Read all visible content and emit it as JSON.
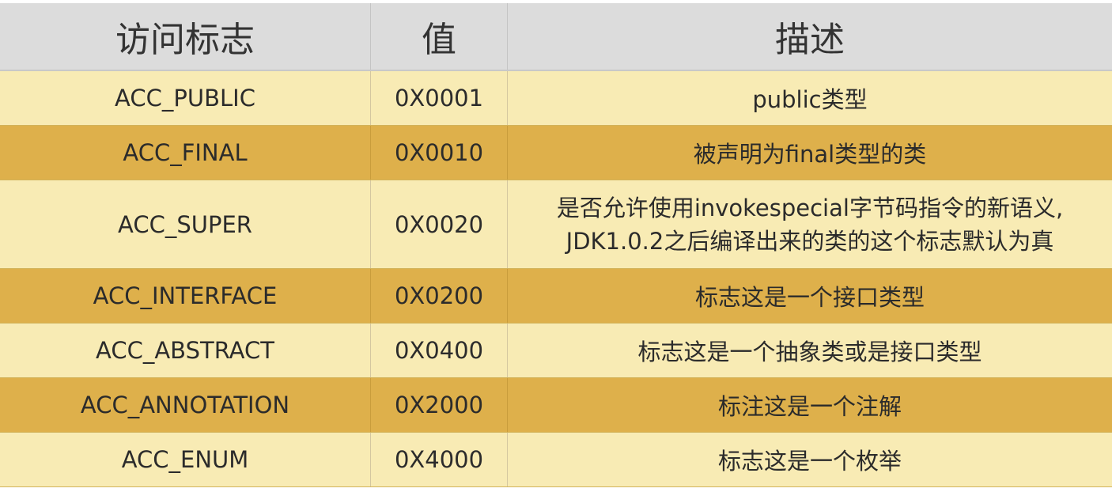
{
  "header": {
    "col1": "访问标志",
    "col2": "值",
    "col3": "描述"
  },
  "rows": [
    {
      "flag": "ACC_PUBLIC",
      "value": "0X0001",
      "desc": "public类型"
    },
    {
      "flag": "ACC_FINAL",
      "value": "0X0010",
      "desc": "被声明为final类型的类"
    },
    {
      "flag": "ACC_SUPER",
      "value": "0X0020",
      "desc_line1": "是否允许使用invokespecial字节码指令的新语义,",
      "desc_line2": "JDK1.0.2之后编译出来的类的这个标志默认为真"
    },
    {
      "flag": "ACC_INTERFACE",
      "value": "0X0200",
      "desc": "标志这是一个接口类型"
    },
    {
      "flag": "ACC_ABSTRACT",
      "value": "0X0400",
      "desc": "标志这是一个抽象类或是接口类型"
    },
    {
      "flag": "ACC_ANNOTATION",
      "value": "0X2000",
      "desc": "标注这是一个注解"
    },
    {
      "flag": "ACC_ENUM",
      "value": "0X4000",
      "desc": "标志这是一个枚举"
    }
  ],
  "colors": {
    "header_bg": "#dcdcdc",
    "row_light": "#f8ebb4",
    "row_dark": "#deb04b"
  }
}
